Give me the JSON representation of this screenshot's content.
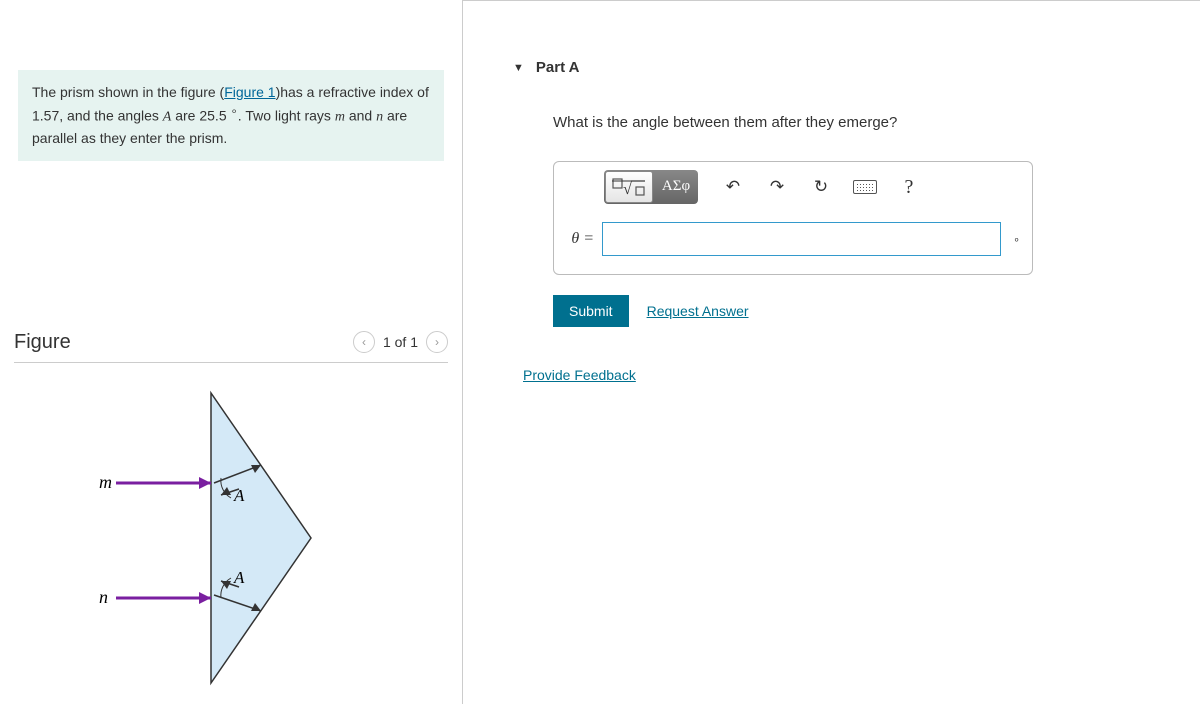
{
  "problem": {
    "pre": "The prism shown in the figure (",
    "figlink": "Figure 1",
    "post1": ")has a refractive index of 1.57, and the angles ",
    "angleVar": "A",
    "post2": " are 25.5 ",
    "post3": ". Two light rays ",
    "rayM": "m",
    "and": " and ",
    "rayN": "n",
    "post4": " are parallel as they enter the prism."
  },
  "figure": {
    "title": "Figure",
    "counter": "1 of 1",
    "labels": {
      "m": "m",
      "n": "n",
      "A1": "A",
      "A2": "A"
    }
  },
  "partA": {
    "title": "Part A",
    "question": "What is the angle between them after they emerge?",
    "toolbar": {
      "templates": "▢√▢",
      "greek": "ΑΣφ",
      "undo": "↶",
      "redo": "↷",
      "reset": "↻",
      "help": "?"
    },
    "thetaLabel": "θ =",
    "unitMark": "∘",
    "submit": "Submit",
    "requestAnswer": "Request Answer"
  },
  "feedback": "Provide Feedback"
}
